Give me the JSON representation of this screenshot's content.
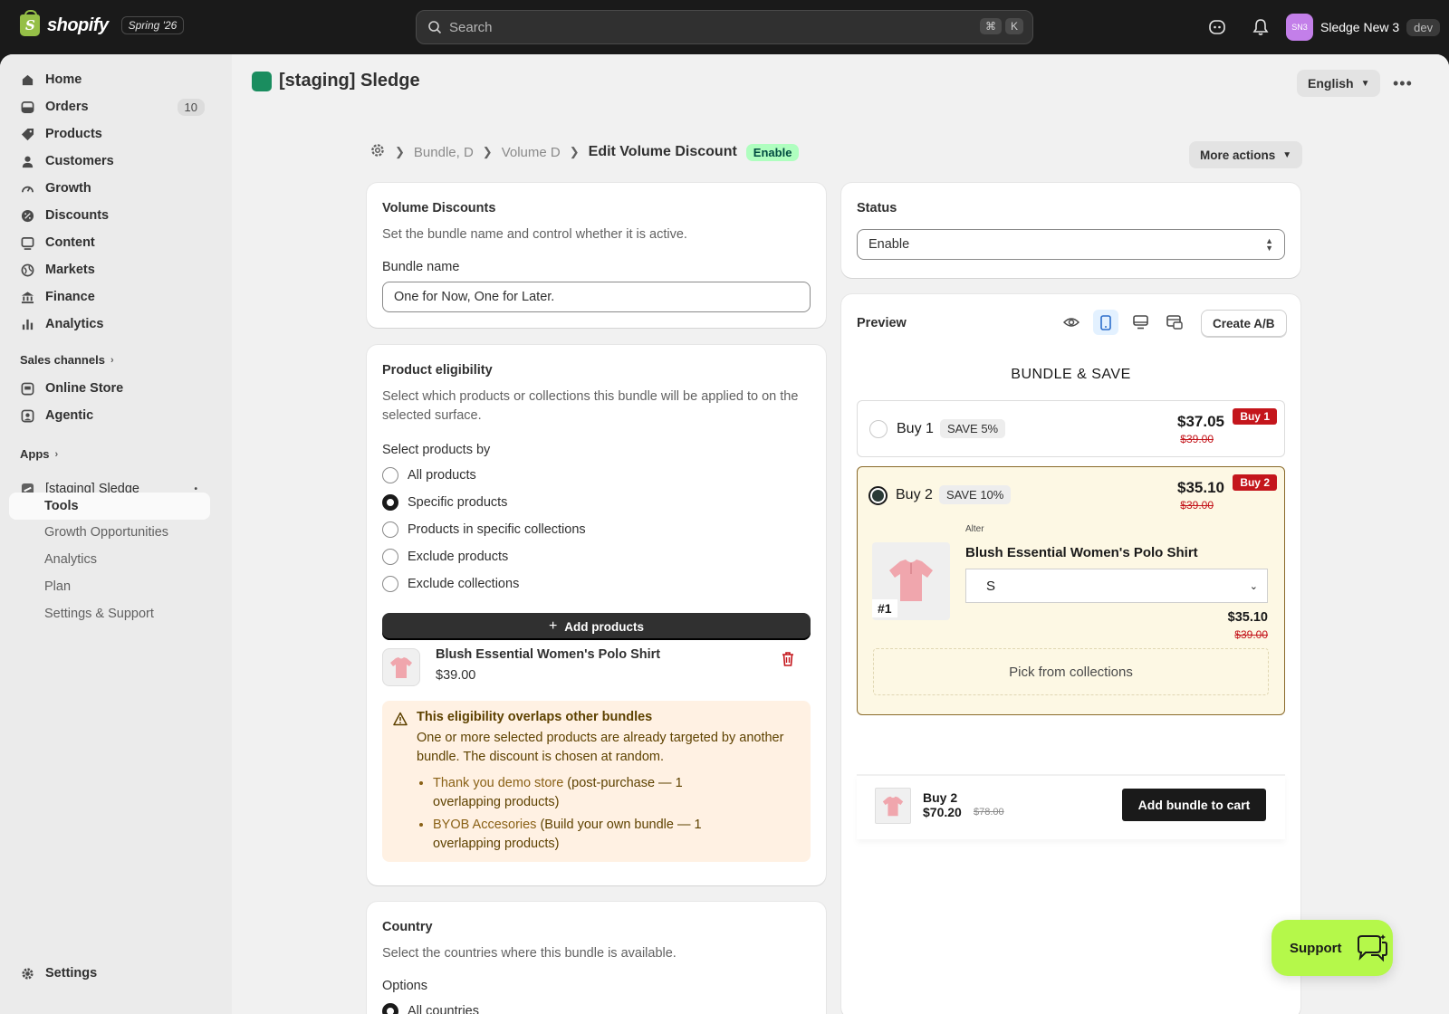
{
  "topbar": {
    "brand": "shopify",
    "edition": "Spring '26",
    "search_placeholder": "Search",
    "shortcut_keys": [
      "⌘",
      "K"
    ],
    "store_initials": "SN3",
    "store_name": "Sledge New 3",
    "env_tag": "dev"
  },
  "sidebar": {
    "items": [
      {
        "label": "Home",
        "icon": "home-icon"
      },
      {
        "label": "Orders",
        "icon": "orders-icon",
        "badge": "10"
      },
      {
        "label": "Products",
        "icon": "tag-icon"
      },
      {
        "label": "Customers",
        "icon": "person-icon"
      },
      {
        "label": "Growth",
        "icon": "gauge-icon"
      },
      {
        "label": "Discounts",
        "icon": "discount-icon"
      },
      {
        "label": "Content",
        "icon": "content-icon"
      },
      {
        "label": "Markets",
        "icon": "globe-icon"
      },
      {
        "label": "Finance",
        "icon": "bank-icon"
      },
      {
        "label": "Analytics",
        "icon": "bar-chart-icon"
      }
    ],
    "sales_channels_label": "Sales channels",
    "channels": [
      {
        "label": "Online Store",
        "icon": "store-icon"
      },
      {
        "label": "Agentic",
        "icon": "agentic-icon"
      }
    ],
    "apps_label": "Apps",
    "app_name": "[staging] Sledge",
    "app_subitems": [
      "Tools",
      "Growth Opportunities",
      "Analytics",
      "Plan",
      "Settings & Support"
    ],
    "settings_label": "Settings"
  },
  "header": {
    "app_title": "[staging] Sledge",
    "language": "English"
  },
  "breadcrumb": {
    "items": [
      "Bundle, D",
      "Volume D"
    ],
    "current": "Edit Volume Discount",
    "status_tag": "Enable",
    "more_actions": "More actions"
  },
  "volume_card": {
    "title": "Volume Discounts",
    "description": "Set the bundle name and control whether it is active.",
    "bundle_name_label": "Bundle name",
    "bundle_name_value": "One for Now, One for Later."
  },
  "eligibility_card": {
    "title": "Product eligibility",
    "description": "Select which products or collections this bundle will be applied to on the selected surface.",
    "select_by_label": "Select products by",
    "options": [
      "All products",
      "Specific products",
      "Products in specific collections",
      "Exclude products",
      "Exclude collections"
    ],
    "selected_option": "Specific products",
    "add_button": "Add products",
    "product_name": "Blush Essential Women's Polo Shirt",
    "product_price": "$39.00",
    "warning_title": "This eligibility overlaps other bundles",
    "warning_text": "One or more selected products are already targeted by another bundle. The discount is chosen at random.",
    "overlaps": [
      {
        "name": "Thank you demo store",
        "detail": " (post-purchase — 1 overlapping products)"
      },
      {
        "name": "BYOB Accesories",
        "detail": " (Build your own bundle — 1 overlapping products)"
      }
    ]
  },
  "country_card": {
    "title": "Country",
    "description": "Select the countries where this bundle is available.",
    "options_label": "Options",
    "first_option": "All countries"
  },
  "status_card": {
    "title": "Status",
    "value": "Enable"
  },
  "preview_card": {
    "title": "Preview",
    "ab_button": "Create A/B",
    "widget_title": "BUNDLE & SAVE",
    "tiers": [
      {
        "name": "Buy 1",
        "save": "SAVE 5%",
        "price": "$37.05",
        "compare": "$39.00",
        "tag": "Buy 1",
        "selected": false
      },
      {
        "name": "Buy 2",
        "save": "SAVE 10%",
        "price": "$35.10",
        "compare": "$39.00",
        "tag": "Buy 2",
        "selected": true
      }
    ],
    "item_label": "Alter",
    "item_name": "Blush Essential Women's Polo Shirt",
    "item_number": "#1",
    "size_value": "S",
    "item_price": "$35.10",
    "item_compare": "$39.00",
    "pick_collections": "Pick from collections",
    "sticky_label": "Buy 2",
    "sticky_price": "$70.20",
    "sticky_compare": "$78.00",
    "cart_button": "Add bundle to cart"
  },
  "support_label": "Support",
  "colors": {
    "accent_green": "#affebf",
    "support_green": "#b5f84a",
    "warning_bg": "#fff1e3",
    "tier_selected_bg": "#fdf8e4",
    "discount_red": "#c4161c"
  }
}
